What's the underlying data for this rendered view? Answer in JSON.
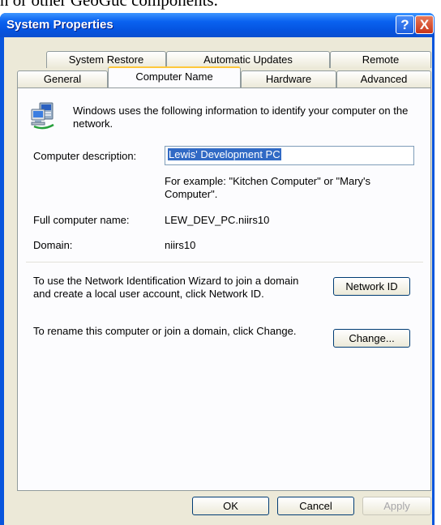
{
  "background_text": "n or other GeoGuc components.",
  "window": {
    "title": "System Properties",
    "help_glyph": "?",
    "close_glyph": "X"
  },
  "tabs": {
    "row_back": [
      "System Restore",
      "Automatic Updates",
      "Remote"
    ],
    "row_front": [
      "General",
      "Computer Name",
      "Hardware",
      "Advanced"
    ],
    "active": "Computer Name"
  },
  "panel": {
    "intro": "Windows uses the following information to identify your computer on the network.",
    "description_label": "Computer description:",
    "description_value": "Lewis' Development PC",
    "example_text": "For example: \"Kitchen Computer\" or \"Mary's Computer\".",
    "full_name_label": "Full computer name:",
    "full_name_value": "LEW_DEV_PC.niirs10",
    "domain_label": "Domain:",
    "domain_value": "niirs10",
    "network_id_text": "To use the Network Identification Wizard to join a domain and create a local user account, click Network ID.",
    "network_id_button": "Network ID",
    "rename_text": "To rename this computer or join a domain, click Change.",
    "change_button": "Change..."
  },
  "buttons": {
    "ok": "OK",
    "cancel": "Cancel",
    "apply": "Apply"
  },
  "colors": {
    "titlebar": "#0a62f0",
    "dialog_face": "#ece9d8",
    "selection": "#316ac5",
    "tab_highlight": "#ffc83c"
  }
}
